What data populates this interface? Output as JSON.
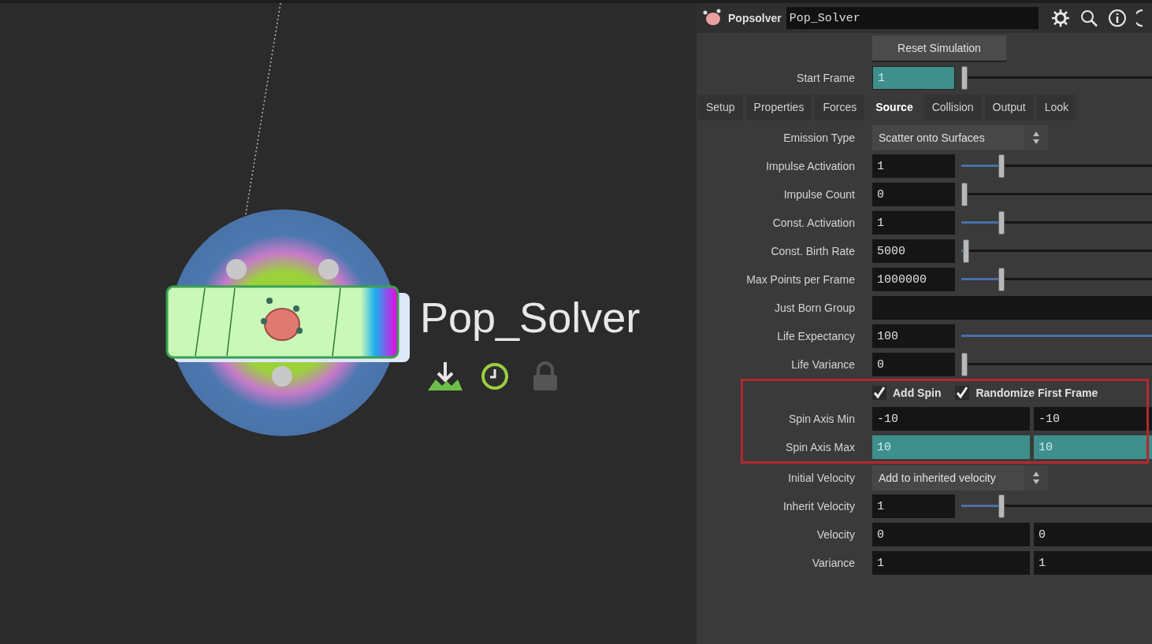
{
  "network": {
    "node": {
      "name": "Pop_Solver"
    }
  },
  "panel": {
    "header": {
      "type_label": "Popsolver",
      "name": "Pop_Solver"
    },
    "reset_button": "Reset Simulation",
    "start_frame": {
      "label": "Start Frame",
      "value": "1",
      "level": 0
    },
    "tabs": [
      {
        "label": "Setup",
        "selected": false
      },
      {
        "label": "Properties",
        "selected": false
      },
      {
        "label": "Forces",
        "selected": false
      },
      {
        "label": "Source",
        "selected": true
      },
      {
        "label": "Collision",
        "selected": false
      },
      {
        "label": "Output",
        "selected": false
      },
      {
        "label": "Look",
        "selected": false
      }
    ],
    "parameters": [
      {
        "kind": "menu",
        "label": "Emission Type",
        "value": "Scatter onto Surfaces",
        "outlined": false
      },
      {
        "kind": "slider",
        "label": "Impulse Activation",
        "value": "1",
        "level": 0.2,
        "outlined": false
      },
      {
        "kind": "slider",
        "label": "Impulse Count",
        "value": "0",
        "level": 0,
        "outlined": false
      },
      {
        "kind": "slider",
        "label": "Const. Activation",
        "value": "1",
        "level": 0.2,
        "outlined": false
      },
      {
        "kind": "slider",
        "label": "Const. Birth Rate",
        "value": "5000",
        "level": 0.01,
        "outlined": false
      },
      {
        "kind": "slider",
        "label": "Max Points per Frame",
        "value": "1000000",
        "level": 0.2,
        "outlined": false
      },
      {
        "kind": "string",
        "label": "Just Born Group",
        "outlined": false
      },
      {
        "kind": "slider",
        "label": "Life Expectancy",
        "value": "100",
        "level": 1,
        "outlined": false
      },
      {
        "kind": "slider",
        "label": "Life Variance",
        "value": "0",
        "level": 0,
        "outlined": false
      },
      {
        "kind": "toggles",
        "outlined": true,
        "toggles": [
          {
            "label": "Add Spin",
            "checked": true
          },
          {
            "label": "Randomize First Frame",
            "checked": true
          }
        ]
      },
      {
        "kind": "vector",
        "label": "Spin Axis Min",
        "values": [
          "-10",
          "-10"
        ],
        "highlighted": false,
        "outlined": true
      },
      {
        "kind": "vector",
        "label": "Spin Axis Max",
        "values": [
          "10",
          "10"
        ],
        "highlighted": true,
        "outlined": true
      },
      {
        "kind": "menu",
        "label": "Initial Velocity",
        "value": "Add to inherited velocity",
        "outlined": false
      },
      {
        "kind": "slider",
        "label": "Inherit Velocity",
        "value": "1",
        "level": 0.2,
        "outlined": false
      },
      {
        "kind": "vector",
        "label": "Velocity",
        "values": [
          "0",
          "0"
        ],
        "highlighted": false,
        "outlined": false
      },
      {
        "kind": "vector",
        "label": "Variance",
        "values": [
          "1",
          "1"
        ],
        "highlighted": false,
        "outlined": false
      }
    ]
  }
}
